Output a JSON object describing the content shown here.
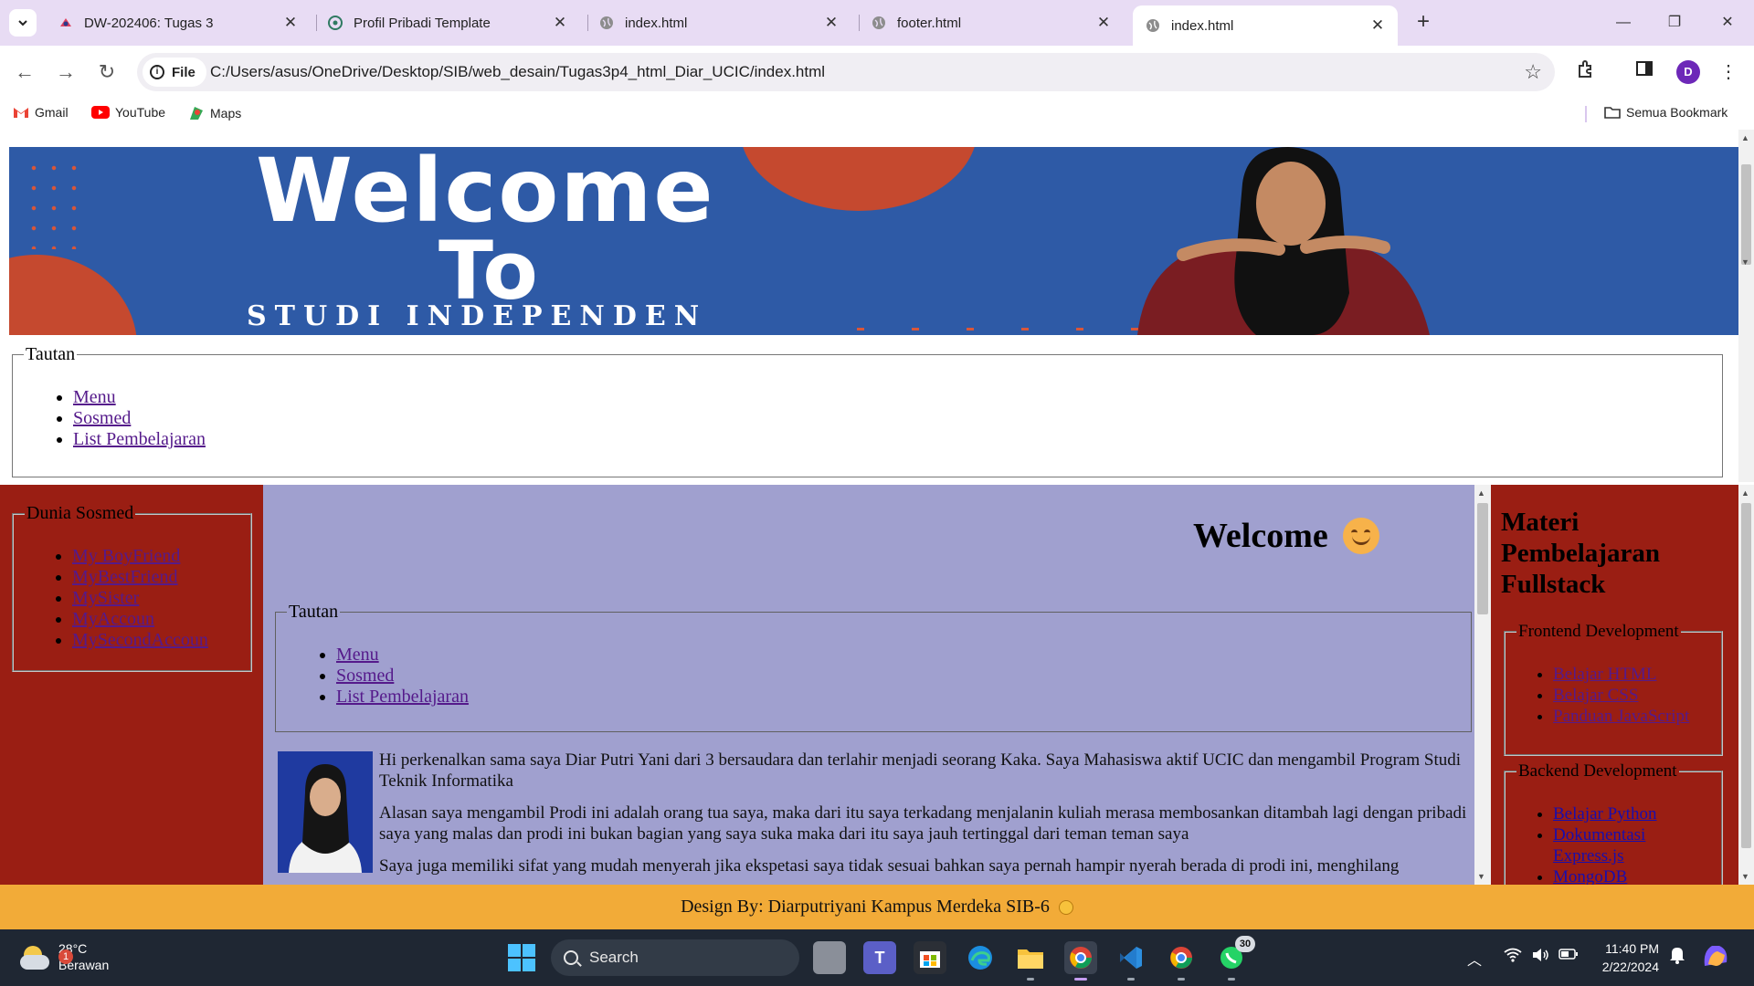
{
  "browser": {
    "tabs": [
      {
        "title": "DW-202406: Tugas 3",
        "icon": "dicoding-icon"
      },
      {
        "title": "Profil Pribadi Template",
        "icon": "chatgpt-icon"
      },
      {
        "title": "index.html",
        "icon": "globe-icon"
      },
      {
        "title": "footer.html",
        "icon": "globe-icon"
      },
      {
        "title": "index.html",
        "icon": "globe-icon",
        "active": true
      }
    ],
    "new_tab": "+",
    "address": {
      "scheme_label": "File",
      "url": "C:/Users/asus/OneDrive/Desktop/SIB/web_desain/Tugas3p4_html_Diar_UCIC/index.html"
    },
    "profile_initial": "D",
    "bookmarks": [
      {
        "label": "Gmail",
        "icon": "gmail-icon"
      },
      {
        "label": "YouTube",
        "icon": "youtube-icon"
      },
      {
        "label": "Maps",
        "icon": "maps-icon"
      }
    ],
    "all_bookmarks": "Semua Bookmark"
  },
  "banner": {
    "line1": "Welcome",
    "line2": "To",
    "line3": "STUDI INDEPENDEN"
  },
  "top_nav": {
    "legend": "Tautan",
    "links": [
      "Menu",
      "Sosmed",
      "List Pembelajaran"
    ]
  },
  "left_sidebar": {
    "legend": "Dunia Sosmed",
    "links": [
      "My BoyFriend",
      "MyBestFriend",
      "MySister",
      "MyAccoun",
      "MySecondAccoun"
    ]
  },
  "center": {
    "title": "Welcome",
    "nav": {
      "legend": "Tautan",
      "links": [
        "Menu",
        "Sosmed",
        "List Pembelajaran"
      ]
    },
    "paragraphs": [
      "Hi perkenalkan sama saya Diar Putri Yani dari 3 bersaudara dan terlahir menjadi seorang Kaka. Saya Mahasiswa aktif UCIC dan mengambil Program Studi Teknik Informatika",
      "Alasan saya mengambil Prodi ini adalah orang tua saya, maka dari itu saya terkadang menjalanin kuliah merasa membosankan ditambah lagi dengan pribadi saya yang malas dan prodi ini bukan bagian yang saya suka maka dari itu saya jauh tertinggal dari teman teman saya",
      "Saya juga memiliki sifat yang mudah menyerah jika ekspetasi saya tidak sesuai bahkan saya pernah hampir nyerah berada di prodi ini, menghilang"
    ]
  },
  "right_sidebar": {
    "title": "Materi Pembelajaran Fullstack",
    "frontend": {
      "legend": "Frontend Development",
      "links": [
        "Belajar HTML",
        "Belajar CSS",
        "Panduan JavaScript"
      ]
    },
    "backend": {
      "legend": "Backend Development",
      "links": [
        "Belajar Python",
        "Dokumentasi Express.js",
        "MongoDB"
      ]
    }
  },
  "footer": {
    "text": "Design By: Diarputriyani Kampus Merdeka SIB-6"
  },
  "taskbar": {
    "weather_temp": "28°C",
    "weather_desc": "Berawan",
    "weather_badge": "1",
    "search_label": "Search",
    "whatsapp_count": "30",
    "time": "11:40 PM",
    "date": "2/22/2024"
  },
  "colors": {
    "tabstrip": "#e8dcf4",
    "sidebar": "#9a1e13",
    "center": "#a0a0cf",
    "footer": "#f2ab38",
    "banner": "#2e5aa6"
  }
}
